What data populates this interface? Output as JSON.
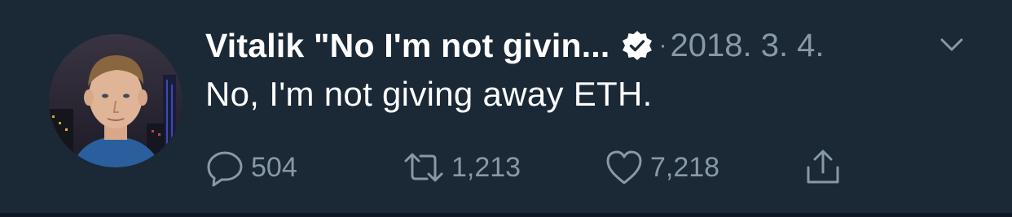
{
  "tweet": {
    "display_name": "Vitalik \"No I'm not givin...",
    "verified_icon": "verified-badge-icon",
    "separator": "·",
    "date": "2018. 3. 4.",
    "text": "No, I'm not giving away ETH."
  },
  "actions": {
    "reply_count": "504",
    "retweet_count": "1,213",
    "like_count": "7,218"
  },
  "colors": {
    "background": "#1b2836",
    "secondary_text": "#8899a6",
    "primary_text": "#ffffff"
  }
}
